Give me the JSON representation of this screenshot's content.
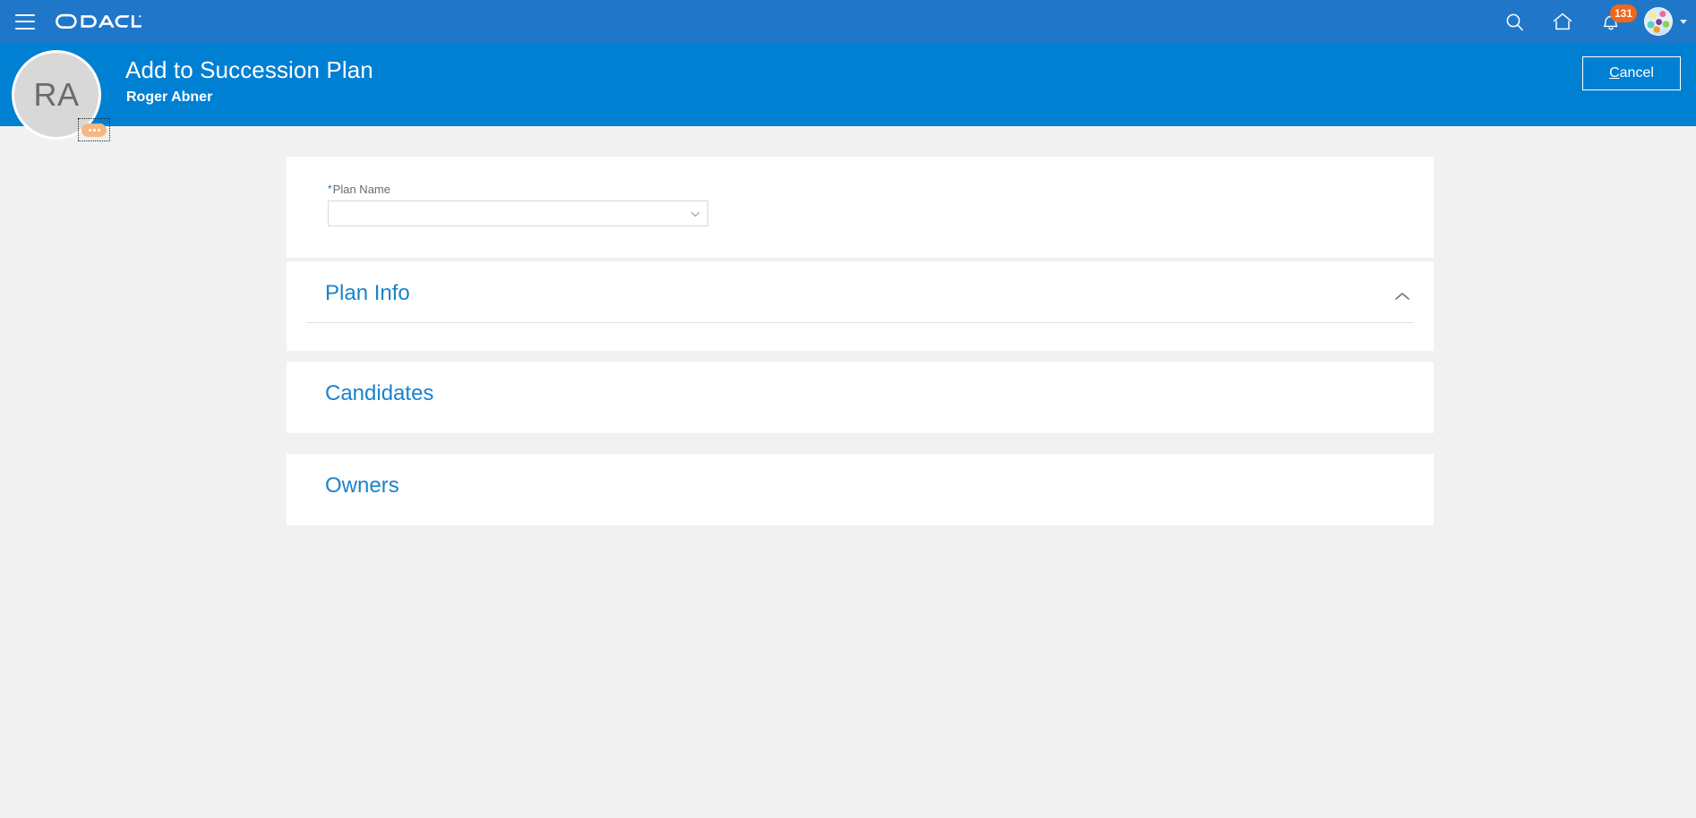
{
  "globalbar": {
    "menu_icon": "hamburger-menu-icon",
    "brand": "ORACLE",
    "brand_trademark": "®",
    "icons": [
      {
        "name": "search-icon",
        "label": "Search"
      },
      {
        "name": "home-icon",
        "label": "Home"
      },
      {
        "name": "notifications-bell-icon",
        "label": "Notifications"
      }
    ],
    "notification_count": "131",
    "notification_badge_color": "#f2661a",
    "avatar": {
      "name": "user-avatar",
      "label": "User"
    },
    "background_color": "#2077ca"
  },
  "pageheader": {
    "title": "Add to Succession Plan",
    "subtitle": "Roger Abner",
    "cancel_label": "Cancel",
    "cancel_accesskey": "C",
    "background_color": "#0080d3"
  },
  "person_avatar": {
    "initials": "RA",
    "more_actions_label": "…",
    "background_color": "#d8d8d8"
  },
  "form": {
    "plan_name": {
      "label": "Plan Name",
      "required_marker": "*",
      "value": "",
      "placeholder": "",
      "arrow_icon": "chevron-down-icon"
    }
  },
  "sections": [
    {
      "title": "Plan Info",
      "collapsible": true,
      "expanded": true,
      "toggle_icon": "chevron-up-icon",
      "has_divider": true
    },
    {
      "title": "Candidates",
      "collapsible": false,
      "expanded": false,
      "toggle_icon": "",
      "has_divider": false
    },
    {
      "title": "Owners",
      "collapsible": false,
      "expanded": false,
      "toggle_icon": "",
      "has_divider": false
    }
  ],
  "theme": {
    "page_background": "#f1f1f1",
    "card_background": "#ffffff",
    "link_blue": "#1b82cc",
    "label_grey": "#6b6b6b"
  }
}
